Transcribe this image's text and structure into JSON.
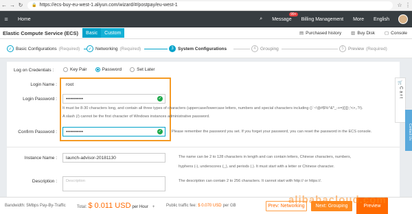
{
  "browser": {
    "url": "https://ecs-buy-eu-west-1.aliyun.com/wizard/#/postpay/eu-west-1"
  },
  "topnav": {
    "home": "Home",
    "message": "Message",
    "message_badge": "99+",
    "billing": "Billing Management",
    "more": "More",
    "language": "English"
  },
  "titlebar": {
    "title": "Elastic Compute Service (ECS)",
    "tab_basic": "Basic",
    "tab_custom": "Custom",
    "purchased_history": "Purchased history",
    "buy_disk": "Buy Disk",
    "console": "Console"
  },
  "steps": [
    {
      "num": "✓",
      "label": "Basic Configurations",
      "req": "(Required)"
    },
    {
      "num": "✓",
      "label": "Networking",
      "req": "(Required)"
    },
    {
      "num": "3",
      "label": "System Configurations",
      "req": ""
    },
    {
      "num": "4",
      "label": "Grouping",
      "req": ""
    },
    {
      "num": "5",
      "label": "Preview",
      "req": "(Required)"
    }
  ],
  "form": {
    "logon_label": "Log on Credentials :",
    "radio_keypair": "Key Pair",
    "radio_password": "Password",
    "radio_setlater": "Set Later",
    "login_name_label": "Login Name :",
    "login_name_value": "root",
    "login_password_label": "Login Password :",
    "login_password_value": "•••••••••••",
    "password_hint_1": "It must be 8-30 characters long, and contain all three types of characters (uppercase/lowercase letters, numbers and special characters including ()`~!@#$%^&*_-+=|{}[]:;'<>,.?/).",
    "password_hint_2": "A slash (/) cannot be the first character of Windows instances administrative password.",
    "confirm_password_label": "Confirm Password :",
    "confirm_password_value": "•••••••••••",
    "confirm_hint": "Please remember the password you set. If you forget your password, you can reset the password in the ECS console.",
    "instance_name_label": "Instance Name :",
    "instance_name_value": "launch-advisor-20181130",
    "instance_hint_1": "The name can be 2 to 128 characters in length and can contain letters, Chinese characters, numbers,",
    "instance_hint_2": "hyphens (-), underscores (_), and periods (.). It must start with a letter or Chinese character.",
    "description_label": "Description :",
    "description_placeholder": "Description",
    "description_hint": "The description can contain 2 to 256 characters. It cannot start with http:// or https://."
  },
  "cart": {
    "label": "Cart"
  },
  "contact": {
    "label": "Contact Us"
  },
  "bottombar": {
    "bandwidth": "Bandwidth: 5Mbps Pay-By-Traffic",
    "total_label": "Total:",
    "total_price": "$ 0.011 USD",
    "total_unit": "per Hour",
    "traffic_label": "Public traffic fee:",
    "traffic_price": "$ 0.070 USD",
    "traffic_unit": "per GB",
    "prev_button": "Prev: Networking",
    "next_button": "Next: Grouping",
    "preview_button": "Preview"
  },
  "watermark": "alibabacloud.com",
  "colors": {
    "accent": "#00a2ca",
    "orange": "#ff6a00",
    "highlight": "#f59a23",
    "success": "#1fa94b"
  }
}
